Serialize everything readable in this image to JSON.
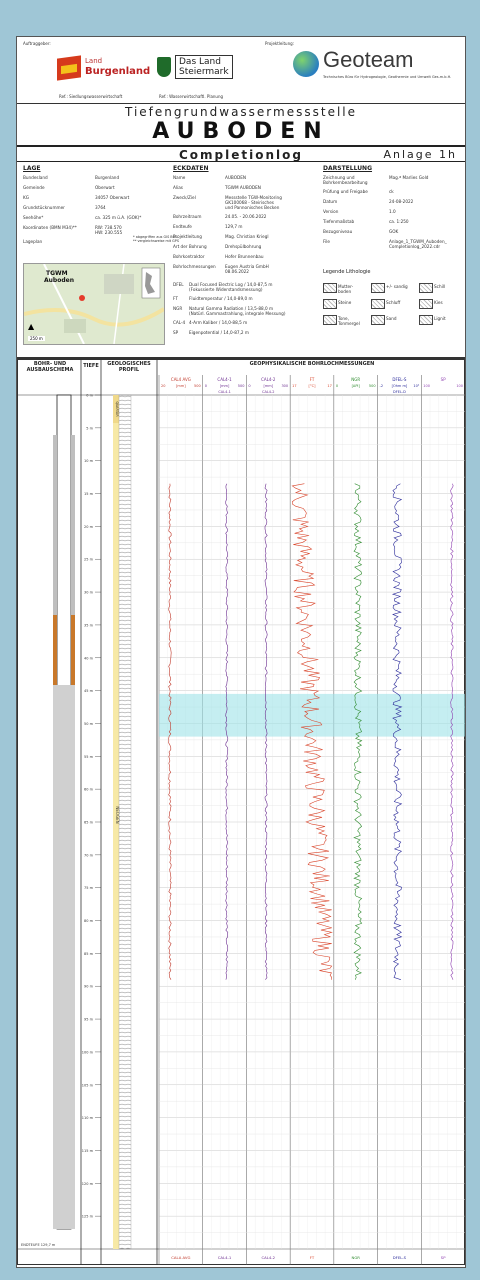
{
  "header": {
    "auftraggeber_label": "Auftraggeber:",
    "projektleitung_label": "Projektleitung:",
    "land1_small": "Land",
    "land1_name": "Burgenland",
    "land2_line1": "Das Land",
    "land2_line2": "Steiermark",
    "ref1": "Ref.: Siedlungswasserwirtschaft",
    "ref2": "Ref.: Wasserwirtschaftl. Planung",
    "geoteam_name": "Geoteam",
    "geoteam_sub": "Technisches Büro für Hydrogeologie, Geothermie und Umwelt Ges.m.b.H.",
    "title1": "Tiefengrundwassermessstelle",
    "title2": "AUBODEN",
    "subtitle": "Completionlog",
    "anlage": "Anlage 1h"
  },
  "lage": {
    "title": "LAGE",
    "rows": [
      [
        "Bundesland",
        "Burgenland"
      ],
      [
        "Gemeinde",
        "Oberwart"
      ],
      [
        "KG",
        "34057 Oberwart"
      ],
      [
        "Grundstücknummer",
        "3764"
      ],
      [
        "Seehöhe*",
        "ca. 325 m ü.A. (GOK)*"
      ],
      [
        "Koordinaten (BMN M34)**",
        "RW: 738.570\nHW: 230.555"
      ],
      [
        "Lageplan",
        ""
      ]
    ],
    "note": "* abgegriffen aus GIS BGL.\n** vergleichsweise mit GPS",
    "map_label1": "TGWM",
    "map_label2": "Auboden",
    "map_scale": "250 m"
  },
  "eckdaten": {
    "title": "ECKDATEN",
    "rows": [
      [
        "Name",
        "AUBODEN"
      ],
      [
        "Alias",
        "TGWM AUBODEN"
      ],
      [
        "Zweck/Ziel",
        "Messstelle TGW-Monitoring\nGK100068 - Steirisches\nund Pannonisches Becken"
      ],
      [
        "Bohrzeitraum",
        "24.05. - 20.06.2022"
      ],
      [
        "Endteufe",
        "129,7 m"
      ],
      [
        "Projektleitung",
        "Mag. Christian Kriegl"
      ],
      [
        "Art der Bohrung",
        "Drehspülbohrung"
      ],
      [
        "Bohrkontraktor",
        "Hofer Brunnenbau"
      ],
      [
        "Bohrlochmessungen",
        "Eugen Austria GmbH\n08.06.2022"
      ]
    ],
    "logs": [
      [
        "DFEL",
        "Dual Focused Electric Log / 14,0-87,5 m\n(Fokussierte Widerstandsmessung)"
      ],
      [
        "FT",
        "Fluidtemperatur / 14,0-89,0 m"
      ],
      [
        "NGR",
        "Natural Gamma Radiation / 13,5-88,0 m\n(Natürl. Gammastrahlung, integrale Messung)"
      ],
      [
        "CAL-4",
        "4-Arm Kaliber / 14,0-88,5 m"
      ],
      [
        "SP",
        "Eigenpotential / 14,0-87,2 m"
      ]
    ]
  },
  "darstellung": {
    "title": "DARSTELLUNG",
    "rows": [
      [
        "Zeichnung und\nBohrkernbearbeitung",
        "Mag.ª Marlies Gold"
      ],
      [
        "Prüfung und Freigabe",
        "ck"
      ],
      [
        "Datum",
        "24-08-2022"
      ],
      [
        "Version",
        "1.0"
      ],
      [
        "Tiefenmaßstab",
        "ca. 1:250"
      ],
      [
        "Bezugsniveau",
        "GOK"
      ],
      [
        "File",
        "Anlage_1_TGWM_Auboden_\nCompletionlog_2022.cdr"
      ]
    ],
    "legend_title": "Legende Lithologie",
    "legend": [
      "Mutter-\nboden",
      "+/- sandig",
      "Schill",
      "Steine",
      "Schluff",
      "Kies",
      "Tone,\nTonmergel",
      "Sand",
      "Lignit"
    ]
  },
  "log": {
    "col1": "BOHR- UND\nAUSBAUSCHEMA",
    "col2": "TIEFE",
    "col3": "GEOLOGISCHES\nPROFIL",
    "col4": "GEOPHYSIKALISCHE BOHRLOCHMESSUNGEN",
    "neogen": "NEOGEN",
    "quartaer": "QUARTÄR",
    "depth_ticks": [
      "0 m",
      "5 m",
      "10 m",
      "15 m",
      "20 m",
      "25 m",
      "30 m",
      "35 m",
      "40 m",
      "45 m",
      "50 m",
      "55 m",
      "60 m",
      "65 m",
      "70 m",
      "75 m",
      "80 m",
      "85 m",
      "90 m",
      "95 m",
      "100 m",
      "105 m",
      "110 m",
      "115 m",
      "120 m",
      "125 m"
    ],
    "endteufe_label": "ENDTEUFE 129,7 m",
    "tracks": [
      {
        "name": "CAL4 AVG",
        "left": "20",
        "unit": "[mm]",
        "right": "500",
        "color": "#c0392b"
      },
      {
        "name": "CAL4-1",
        "left": "0",
        "unit": "[mm]",
        "right": "500",
        "color": "#6b2d8f",
        "sub": "CAL4-1",
        "sub_l": "200",
        "sub_r": "0"
      },
      {
        "name": "CAL4-2",
        "left": "0",
        "unit": "[mm]",
        "right": "300",
        "color": "#6b2d8f",
        "sub": "CAL4-2",
        "sub_l": "0",
        "sub_r": "250"
      },
      {
        "name": "FT",
        "left": "17",
        "unit": "[°C]",
        "right": "17",
        "color": "#d9452b"
      },
      {
        "name": "NGR",
        "left": "0",
        "unit": "[API]",
        "right": "500",
        "color": "#2e8b2e"
      },
      {
        "name": "DFEL-S",
        "left": "-2",
        "unit": "[Ohm m]",
        "right": "10²",
        "color": "#2a2a9a",
        "sub": "DFEL-D"
      },
      {
        "name": "SP",
        "left": "100",
        "unit": "",
        "right": "100",
        "color": "#8e3fb0"
      }
    ],
    "footer_tracks": [
      "CALA AVG",
      "CAL4-1",
      "CAL4-2",
      "FT",
      "NGR",
      "DFEL-S",
      "SP"
    ]
  }
}
